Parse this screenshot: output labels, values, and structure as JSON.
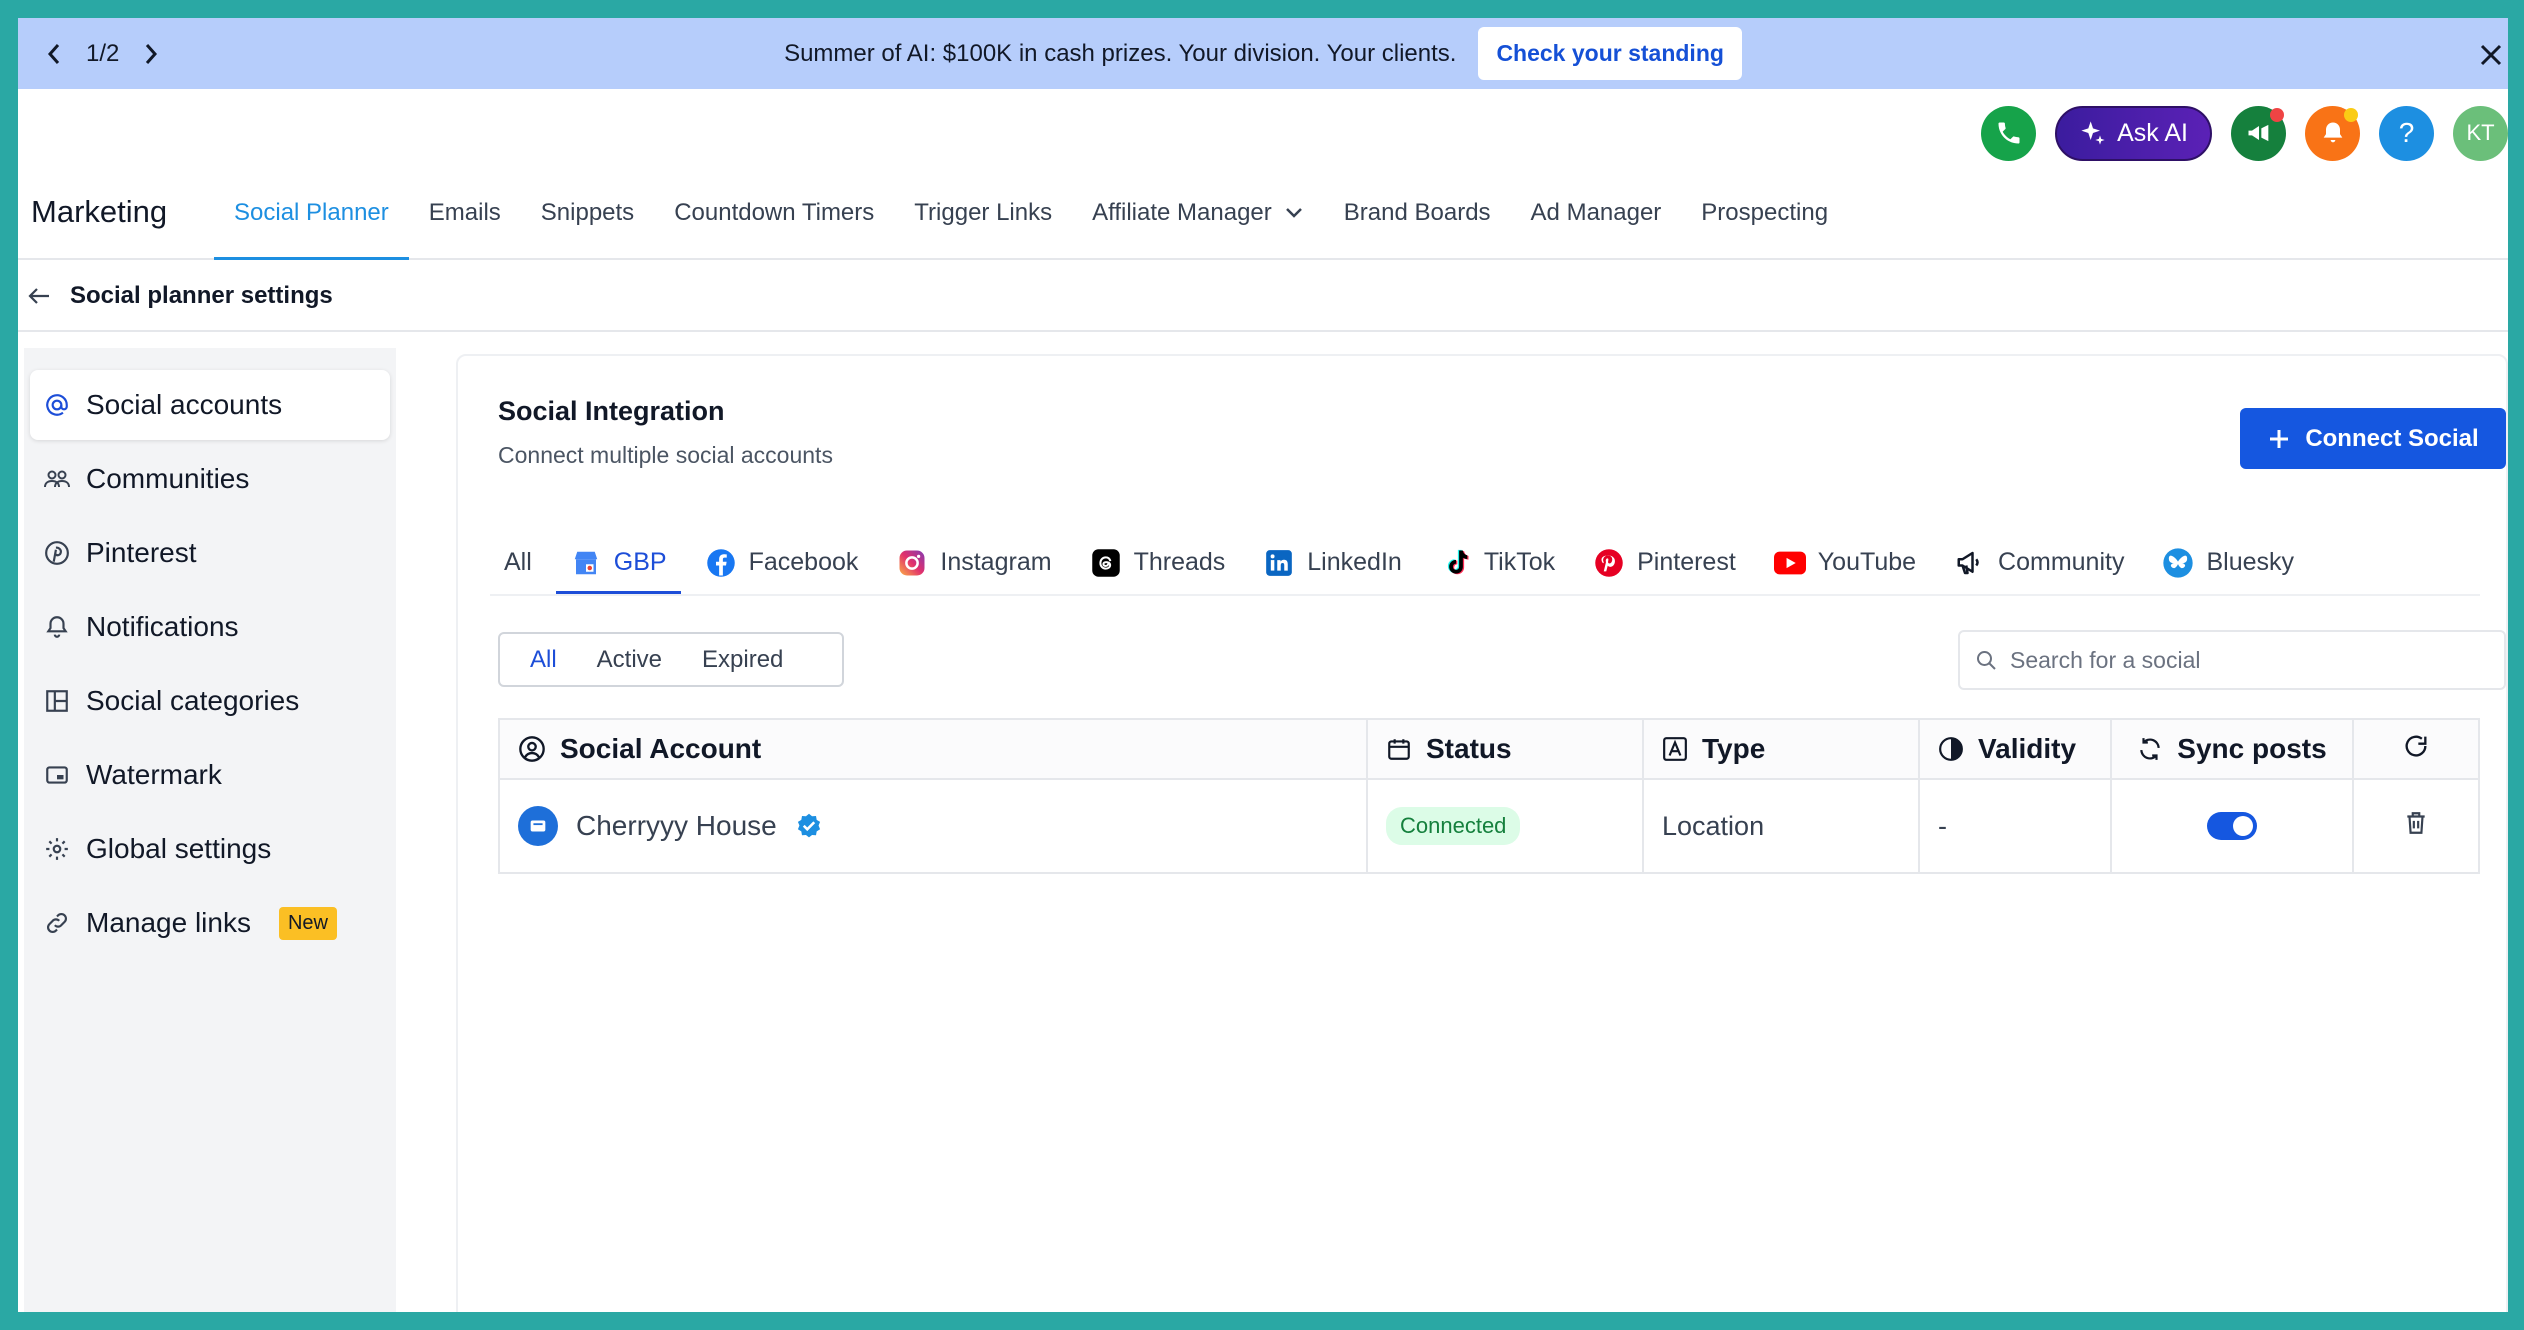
{
  "banner": {
    "pager": "1/2",
    "text": "Summer of AI: $100K in cash prizes. Your division. Your clients.",
    "cta": "Check your standing"
  },
  "topbar": {
    "ask_ai": "Ask AI",
    "help": "?",
    "avatar_initials": "KT"
  },
  "nav": {
    "brand": "Marketing",
    "tabs": [
      {
        "label": "Social Planner",
        "active": true
      },
      {
        "label": "Emails"
      },
      {
        "label": "Snippets"
      },
      {
        "label": "Countdown Timers"
      },
      {
        "label": "Trigger Links"
      },
      {
        "label": "Affiliate Manager",
        "dropdown": true
      },
      {
        "label": "Brand Boards"
      },
      {
        "label": "Ad Manager"
      },
      {
        "label": "Prospecting"
      }
    ]
  },
  "settings": {
    "title": "Social planner settings"
  },
  "sidebar": {
    "items": [
      {
        "label": "Social accounts",
        "icon": "at-icon",
        "active": true
      },
      {
        "label": "Communities",
        "icon": "people-icon"
      },
      {
        "label": "Pinterest",
        "icon": "pinterest-icon"
      },
      {
        "label": "Notifications",
        "icon": "bell-icon"
      },
      {
        "label": "Social categories",
        "icon": "layout-icon"
      },
      {
        "label": "Watermark",
        "icon": "watermark-icon"
      },
      {
        "label": "Global settings",
        "icon": "gear-icon"
      },
      {
        "label": "Manage links",
        "icon": "link-icon",
        "badge": "New"
      }
    ]
  },
  "main": {
    "title": "Social Integration",
    "subtitle": "Connect multiple social accounts",
    "connect_button": "Connect Social",
    "platform_tabs": [
      {
        "label": "All"
      },
      {
        "label": "GBP",
        "active": true
      },
      {
        "label": "Facebook"
      },
      {
        "label": "Instagram"
      },
      {
        "label": "Threads"
      },
      {
        "label": "LinkedIn"
      },
      {
        "label": "TikTok"
      },
      {
        "label": "Pinterest"
      },
      {
        "label": "YouTube"
      },
      {
        "label": "Community"
      },
      {
        "label": "Bluesky"
      }
    ],
    "filters": [
      {
        "label": "All",
        "active": true
      },
      {
        "label": "Active"
      },
      {
        "label": "Expired"
      }
    ],
    "search_placeholder": "Search for a social",
    "table": {
      "headers": [
        "Social Account",
        "Status",
        "Type",
        "Validity",
        "Sync posts"
      ],
      "rows": [
        {
          "account": "Cherryyy House",
          "status": "Connected",
          "type": "Location",
          "validity": "-",
          "sync": true
        }
      ]
    }
  },
  "colors": {
    "accent": "#1557e0",
    "active_tab": "#1d8fe1",
    "banner_bg": "#b6cdfb",
    "frame_border": "#2aa8a4"
  }
}
